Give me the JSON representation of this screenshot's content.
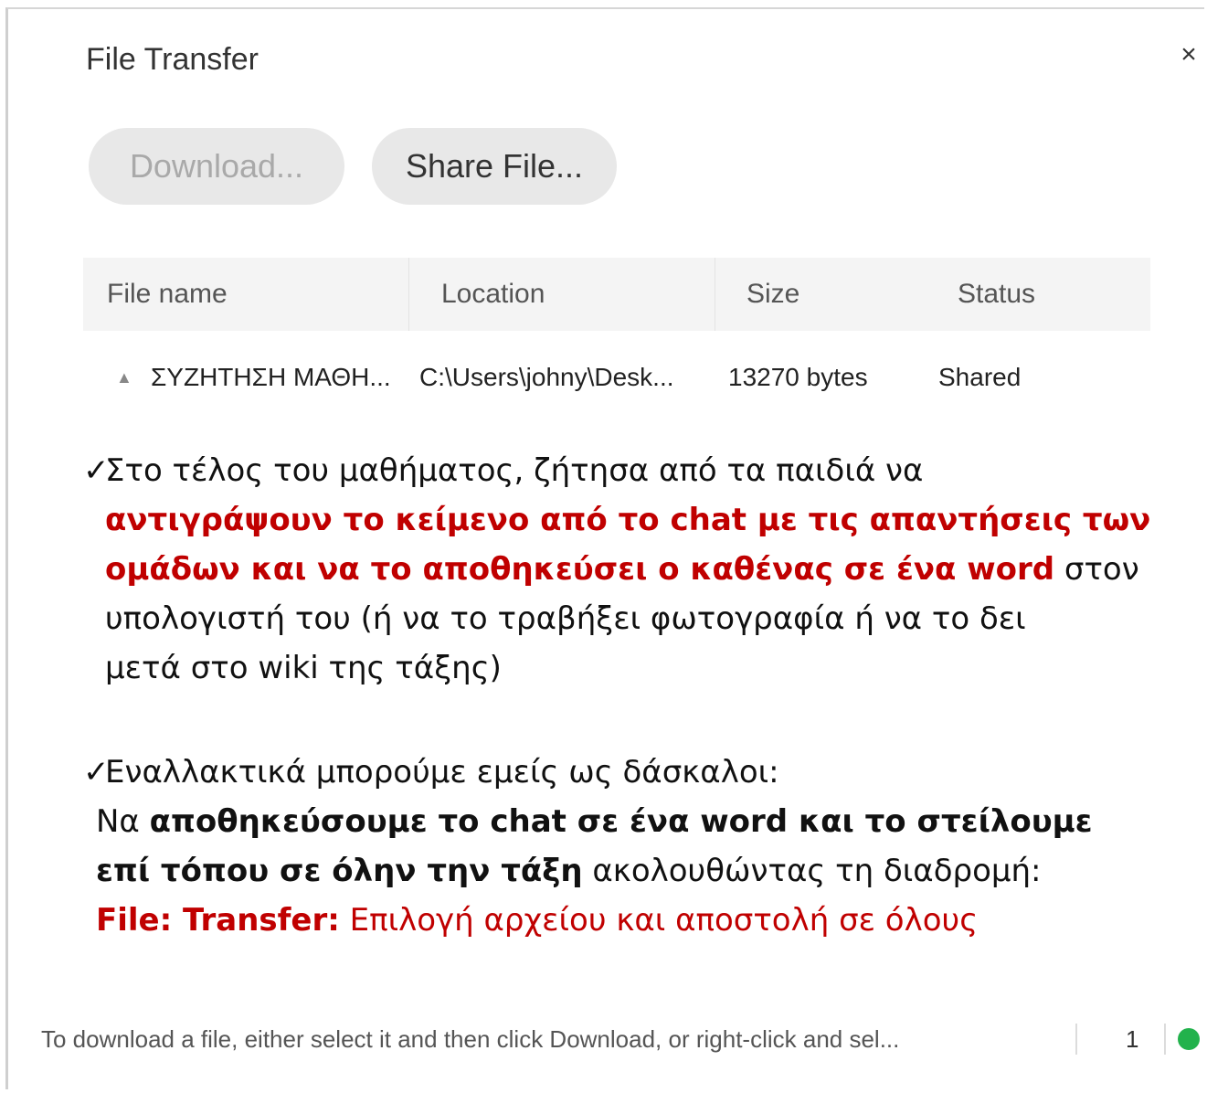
{
  "window": {
    "title": "File Transfer",
    "close_symbol": "×"
  },
  "toolbar": {
    "download_label": "Download...",
    "share_label": "Share File..."
  },
  "table": {
    "columns": [
      "File name",
      "Location",
      "Size",
      "Status"
    ],
    "rows": [
      {
        "name": "ΣΥΖΗΤΗΣΗ ΜΑΘΗ...",
        "location": "C:\\Users\\johny\\Desk...",
        "size": "13270 bytes",
        "status": "Shared"
      }
    ]
  },
  "notes": {
    "check_symbol": "✓",
    "note1": {
      "line1": "Στο τέλος του μαθήματος, ζήτησα από τα παιδιά να",
      "line2": "αντιγράψουν το κείμενο από το chat με τις απαντήσεις των",
      "line3_red": "ομάδων και να το αποθηκεύσει ο καθένας σε ένα word",
      "line3_rest": " στον",
      "line4": "υπολογιστή του (ή να το τραβήξει φωτογραφία ή να το δει",
      "line5": "μετά στο wiki της τάξης)"
    },
    "note2": {
      "line1": "Εναλλακτικά μπορούμε εμείς ως δάσκαλοι:",
      "line2_pre": "Να ",
      "line2_bold": "αποθηκεύσουμε το chat σε ένα word και το στείλουμε",
      "line3_bold": "επί τόπου σε όλην την τάξη",
      "line3_rest": " ακολουθώντας τη διαδρομή:",
      "line4_bold": "File: Transfer:",
      "line4_rest": " Επιλογή αρχείου και αποστολή σε όλους"
    }
  },
  "footer": {
    "hint": "To download a file, either select it and then click Download, or right-click and sel...",
    "count": "1"
  },
  "colors": {
    "accent_red": "#c00000",
    "status_green": "#22b24c"
  }
}
